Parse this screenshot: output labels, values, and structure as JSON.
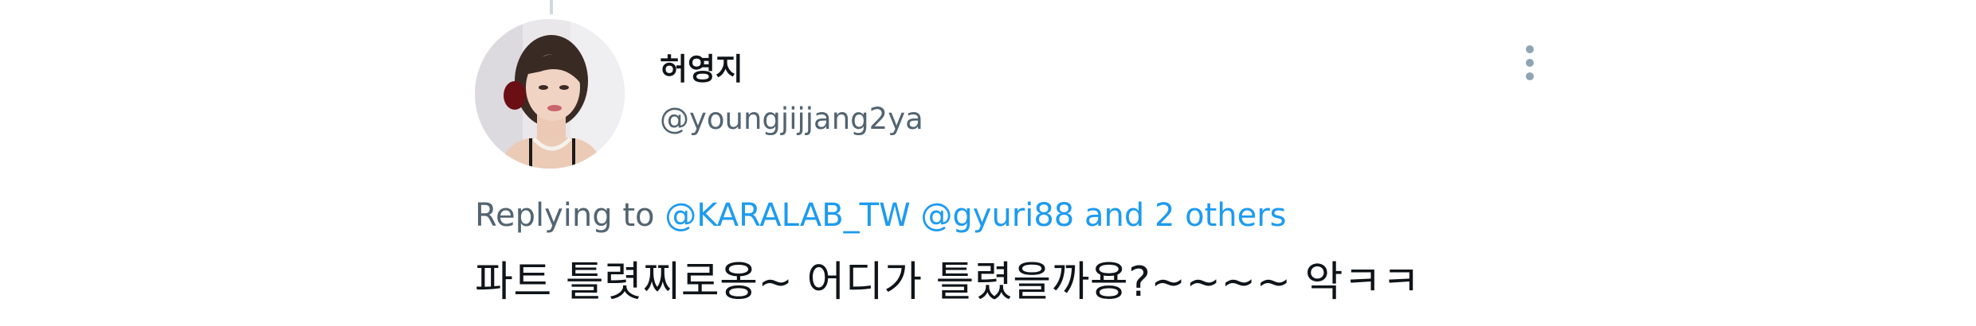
{
  "tweet": {
    "display_name": "허영지",
    "handle": "@youngjijjang2ya",
    "replying_prefix": "Replying to",
    "mentions": [
      "@KARALAB_TW",
      "@gyuri88"
    ],
    "others_link": "and 2 others",
    "text": "파트 틀렷찌로옹~ 어디가 틀렸을까용?~~~~ 악ㅋㅋ"
  },
  "icons": {
    "more": "more-vertical-icon",
    "avatar": "profile-photo"
  },
  "colors": {
    "text_primary": "#0f1419",
    "text_secondary": "#536471",
    "link": "#1d9bf0",
    "icon_gray": "#8fa5b5"
  }
}
